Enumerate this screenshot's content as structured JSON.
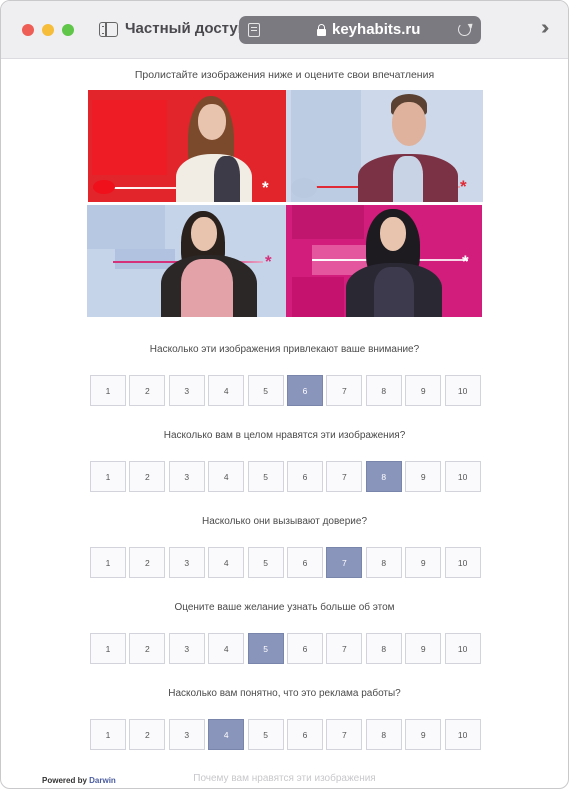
{
  "browser": {
    "private_label": "Частный доступ",
    "url": "keyhabits.ru"
  },
  "survey": {
    "intro": "Пролистайте изображения ниже и оцените свои впечатления",
    "images": [
      {
        "background": "#e2242b",
        "accent": "#f01c24"
      },
      {
        "background": "#cdd9ea",
        "accent": "#e02a35"
      },
      {
        "background": "#c6d4ea",
        "accent": "#d4317a"
      },
      {
        "background": "#d21d7d",
        "accent": "#b01768"
      }
    ],
    "scale_labels": [
      "1",
      "2",
      "3",
      "4",
      "5",
      "6",
      "7",
      "8",
      "9",
      "10"
    ],
    "questions": [
      {
        "text": "Насколько эти изображения привлекают ваше внимание?",
        "selected": 6
      },
      {
        "text": "Насколько вам в целом нравятся эти изображения?",
        "selected": 8
      },
      {
        "text": "Насколько они вызывают доверие?",
        "selected": 7
      },
      {
        "text": "Оцените ваше желание узнать больше об этом",
        "selected": 5
      },
      {
        "text": "Насколько вам понятно, что это реклама работы?",
        "selected": 4
      }
    ],
    "next_question_partial": "Почему вам нравятся эти изображения"
  },
  "footer": {
    "powered_prefix": "Powered by",
    "powered_brand": "Darwin"
  },
  "colors": {
    "selected": "#8a95bb",
    "brand": "#4a5ca0"
  }
}
